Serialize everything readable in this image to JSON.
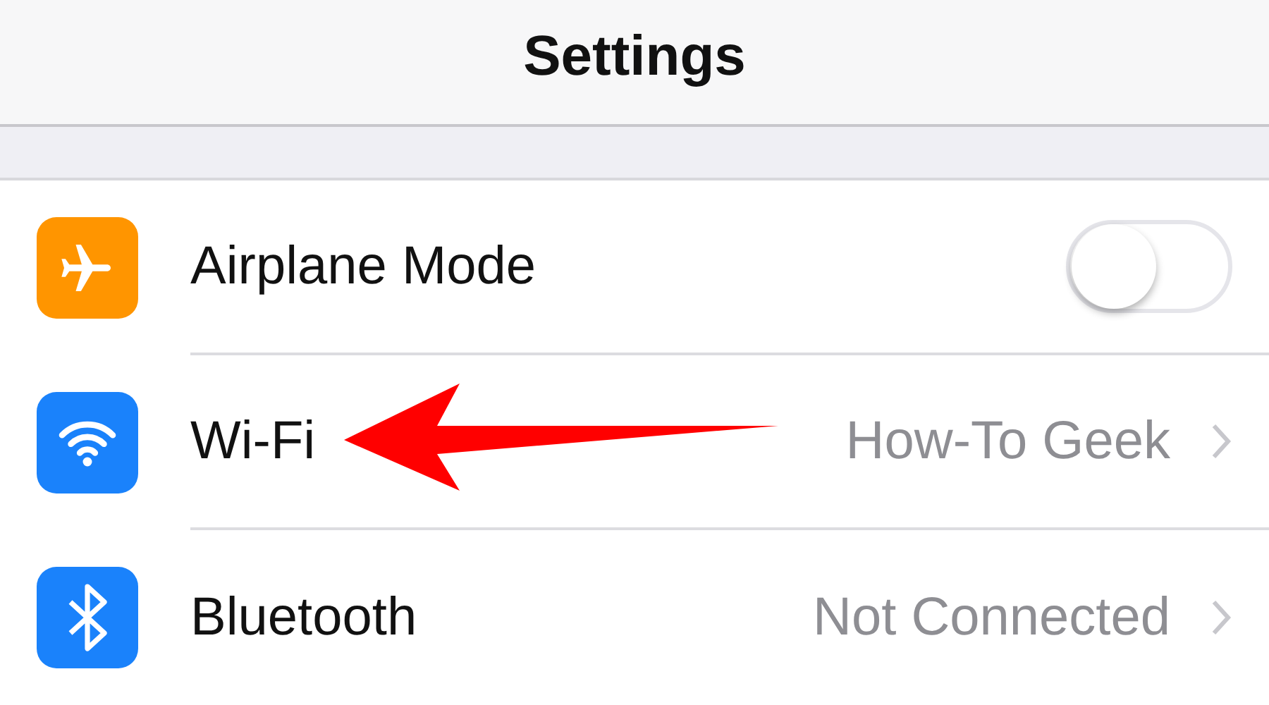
{
  "nav_bar": {
    "title": "Settings"
  },
  "rows": [
    {
      "kind": "toggle",
      "label": "Airplane Mode",
      "color": "#ff9500",
      "on": false
    },
    {
      "kind": "link",
      "label": "Wi-Fi",
      "color": "#1a82fb",
      "value": "How-To Geek"
    },
    {
      "kind": "link",
      "label": "Bluetooth",
      "color": "#1a82fb",
      "value": "Not Connected"
    }
  ]
}
